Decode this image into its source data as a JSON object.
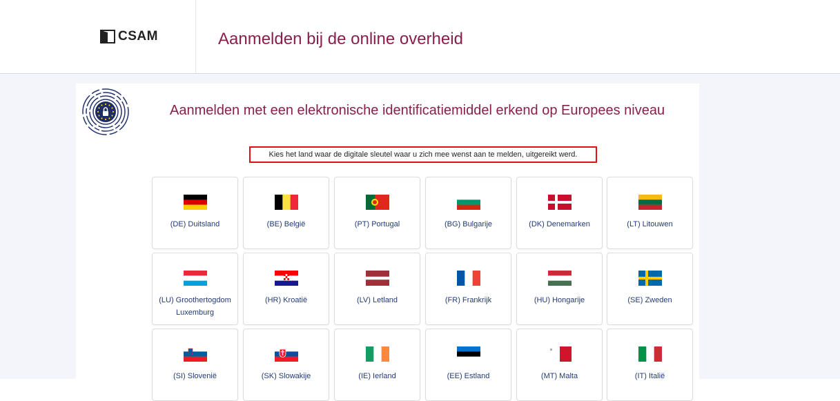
{
  "header": {
    "logo_text": "CSAM",
    "title": "Aanmelden bij de online overheid"
  },
  "section": {
    "title": "Aanmelden met een elektronische identificatiemiddel erkend op Europees niveau",
    "instruction": "Kies het land waar de digitale sleutel waar u zich mee wenst aan te melden, uitgereikt werd."
  },
  "countries": [
    {
      "label": "(DE) Duitsland",
      "flag": "DE"
    },
    {
      "label": "(BE) België",
      "flag": "BE"
    },
    {
      "label": "(PT) Portugal",
      "flag": "PT"
    },
    {
      "label": "(BG) Bulgarije",
      "flag": "BG"
    },
    {
      "label": "(DK) Denemarken",
      "flag": "DK"
    },
    {
      "label": "(LT) Litouwen",
      "flag": "LT"
    },
    {
      "label": "(LU) Groothertogdom Luxemburg",
      "flag": "LU"
    },
    {
      "label": "(HR) Kroatië",
      "flag": "HR"
    },
    {
      "label": "(LV) Letland",
      "flag": "LV"
    },
    {
      "label": "(FR) Frankrijk",
      "flag": "FR"
    },
    {
      "label": "(HU) Hongarije",
      "flag": "HU"
    },
    {
      "label": "(SE) Zweden",
      "flag": "SE"
    },
    {
      "label": "(SI) Slovenië",
      "flag": "SI"
    },
    {
      "label": "(SK) Slowakije",
      "flag": "SK"
    },
    {
      "label": "(IE) Ierland",
      "flag": "IE"
    },
    {
      "label": "(EE) Estland",
      "flag": "EE"
    },
    {
      "label": "(MT) Malta",
      "flag": "MT"
    },
    {
      "label": "(IT) Italië",
      "flag": "IT"
    }
  ],
  "colors": {
    "accent": "#8a1f4b",
    "link": "#223a78",
    "highlight_border": "#dd1111"
  }
}
